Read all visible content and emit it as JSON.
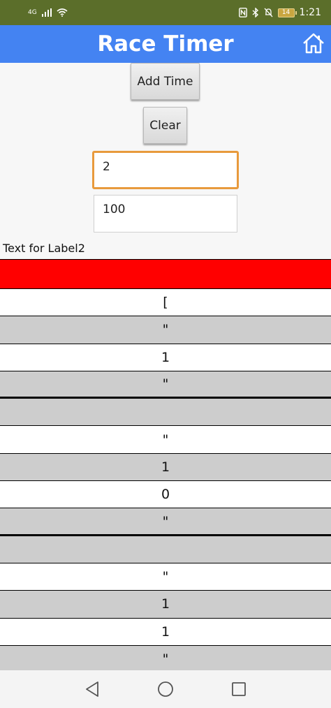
{
  "status_bar": {
    "network": "4G",
    "battery_level": "14",
    "time": "1:21"
  },
  "header": {
    "title": "Race Timer",
    "home_icon": "home-icon"
  },
  "buttons": {
    "add_time": "Add Time",
    "clear": "Clear"
  },
  "inputs": {
    "first_value": "2",
    "second_value": "100"
  },
  "label2": "Text for Label2",
  "list": {
    "items": [
      "[",
      "\"",
      "1",
      "\"",
      "",
      "\"",
      "1",
      "0",
      "\"",
      "",
      "\"",
      "1",
      "1",
      "\""
    ]
  },
  "colors": {
    "status_bar": "#5b6e2a",
    "title_bar": "#4483f2",
    "header_row": "#ff0000",
    "focus_border": "#e89a3c"
  }
}
